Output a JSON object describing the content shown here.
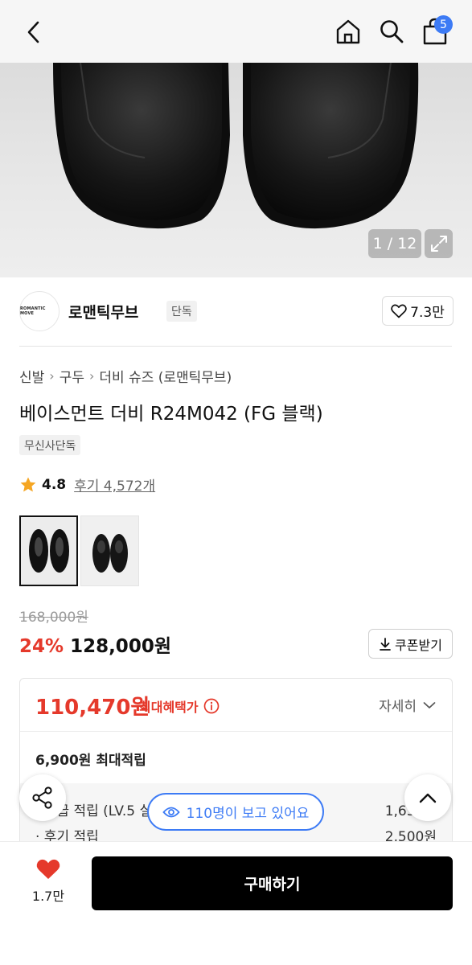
{
  "header": {
    "cart_count": "5",
    "icons": [
      "back-icon",
      "home-icon",
      "search-icon",
      "cart-icon"
    ]
  },
  "gallery": {
    "counter": "1 / 12",
    "icons": [
      "expand-icon"
    ]
  },
  "brand": {
    "logo_text": "ROMANTIC MOVE",
    "name": "로맨틱무브",
    "badge": "단독",
    "likes": "7.3만"
  },
  "breadcrumb": [
    "신발",
    "구두",
    "더비 슈즈 (로맨틱무브)"
  ],
  "product": {
    "title": "베이스먼트 더비 R24M042 (FG 블랙)",
    "exclusive_badge": "무신사단독",
    "rating": "4.8",
    "reviews": "후기 4,572개"
  },
  "price": {
    "original": "168,000원",
    "discount": "24%",
    "sale": "128,000원",
    "coupon_label": "쿠폰받기"
  },
  "benefit": {
    "max_price": "110,470원",
    "max_label": "최대혜택가",
    "detail_label": "자세히",
    "points_summary": "6,900원 최대적립",
    "rows": [
      {
        "label": "· 등급 적립 (LV.5 실버 · 3%)",
        "amount": "1,630원"
      },
      {
        "label": "· 후기 적립",
        "amount": "2,500원"
      }
    ]
  },
  "floating": {
    "viewers": "110명이 보고 있어요"
  },
  "bottom": {
    "wish_count": "1.7만",
    "buy_label": "구매하기"
  },
  "colors": {
    "accent_red": "#e5392b",
    "accent_blue": "#3d7bf5",
    "star": "#f5a623"
  }
}
